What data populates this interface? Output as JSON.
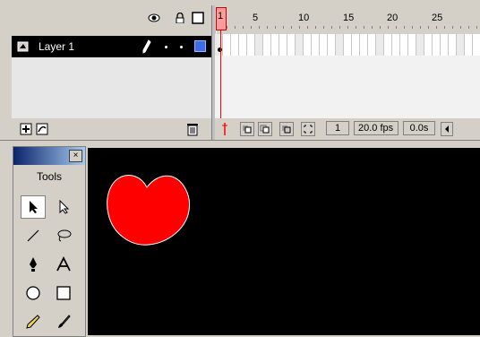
{
  "timeline": {
    "layer_name": "Layer 1",
    "frame_numbers": [
      "1",
      "5",
      "10",
      "15",
      "20",
      "25"
    ],
    "current_frame": "1",
    "fps": "20.0 fps",
    "time": "0.0s",
    "header_icons": [
      "eye-icon",
      "lock-icon",
      "outline-icon"
    ]
  },
  "tools": {
    "label": "Tools",
    "close": "×",
    "items": [
      "arrow-tool",
      "subselect-tool",
      "line-tool",
      "lasso-tool",
      "pen-tool",
      "text-tool",
      "oval-tool",
      "rectangle-tool",
      "pencil-tool",
      "brush-tool"
    ]
  },
  "stage": {
    "background": "#000000",
    "shape_color": "#ff0000"
  }
}
